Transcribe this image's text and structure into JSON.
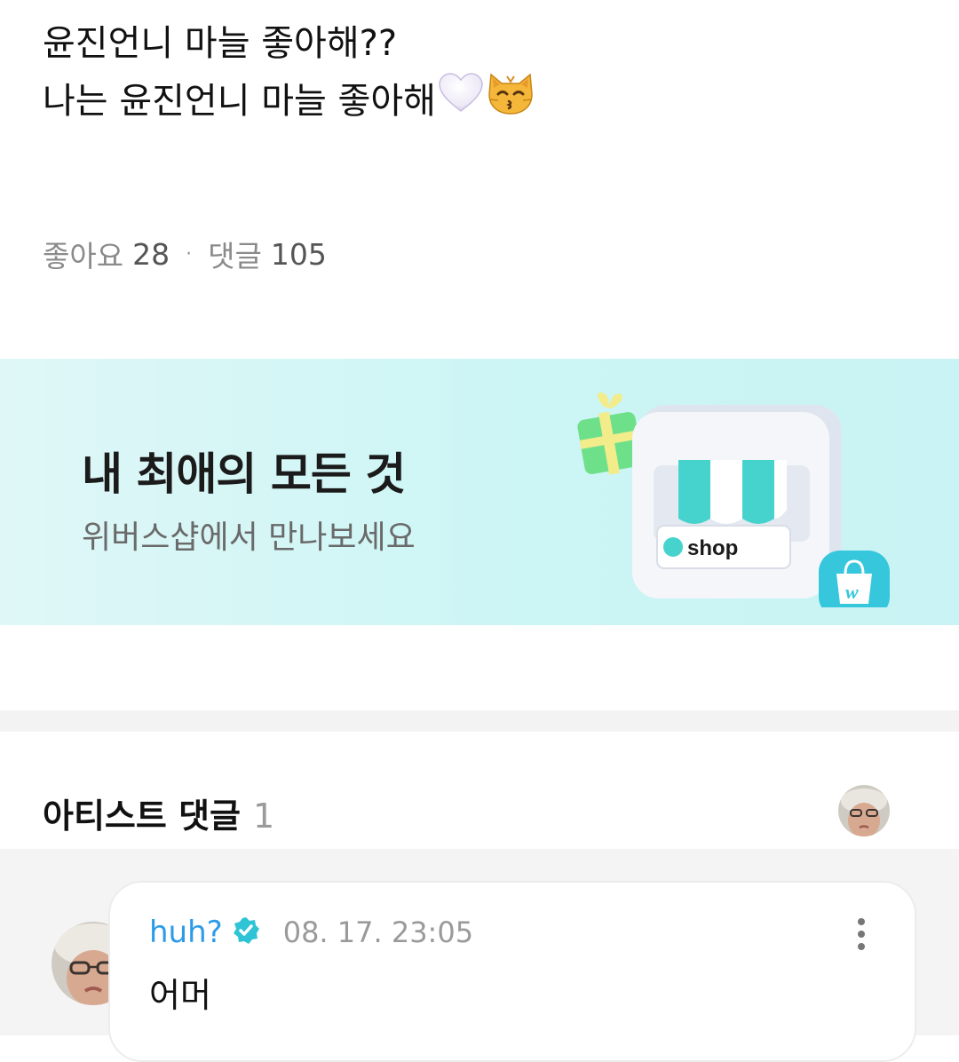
{
  "post": {
    "line1": "윤진언니 마늘 좋아해??",
    "line2": "나는 윤진언니 마늘 좋아해",
    "emojis": [
      "white-heart-icon",
      "kissing-cat-icon"
    ]
  },
  "stats": {
    "likes_label": "좋아요",
    "likes_count": "28",
    "separator": "·",
    "comments_label": "댓글",
    "comments_count": "105"
  },
  "banner": {
    "title": "내 최애의 모든 것",
    "subtitle": "위버스샵에서 만나보세요",
    "store_label": "shop",
    "badge_letter": "w",
    "colors": {
      "bg": "#cff5f5",
      "accent": "#47d1cf"
    }
  },
  "artist_comments": {
    "title": "아티스트 댓글",
    "count": "1"
  },
  "comment": {
    "author": "huh?",
    "timestamp": "08. 17. 23:05",
    "text": "어머",
    "author_color": "#2d9be8"
  }
}
